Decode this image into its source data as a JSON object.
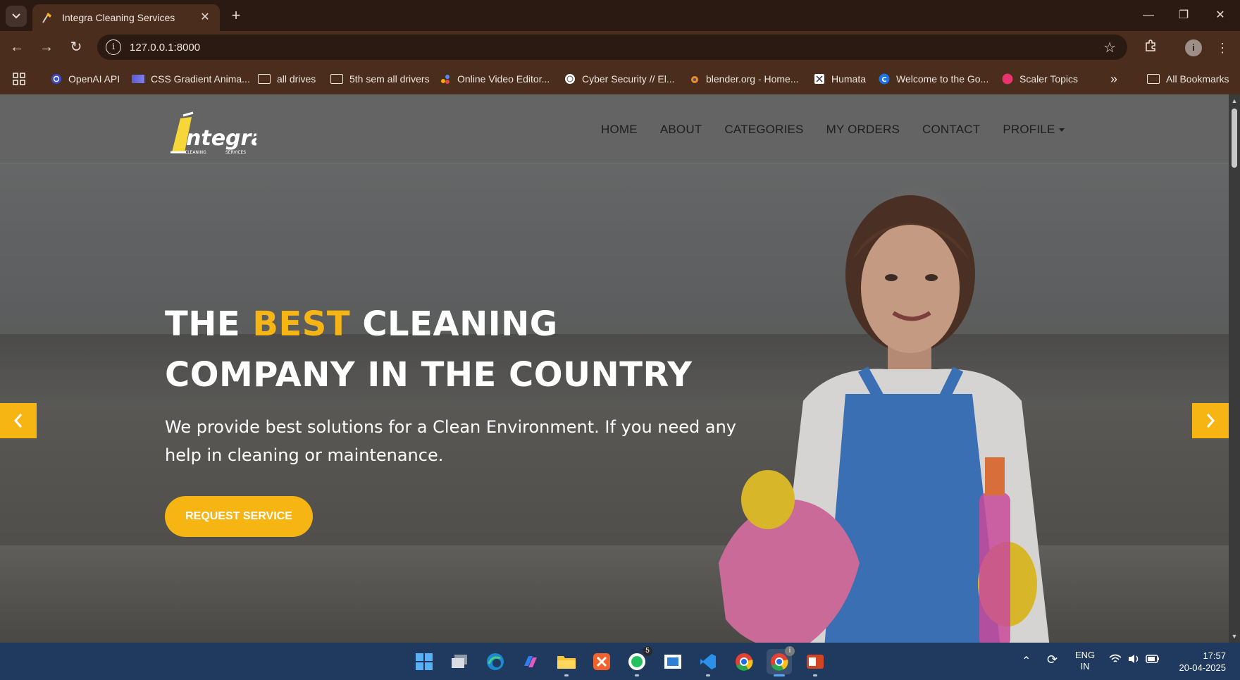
{
  "browser": {
    "tab_title": "Integra Cleaning Services",
    "url": "127.0.0.1:8000",
    "profile_initial": "i",
    "bookmarks": [
      {
        "label": "OpenAI API",
        "icon": "openai-icon"
      },
      {
        "label": "CSS Gradient Anima...",
        "icon": "gradient-icon"
      },
      {
        "label": "all drives",
        "icon": "folder-icon"
      },
      {
        "label": "5th sem all drivers",
        "icon": "folder-icon"
      },
      {
        "label": "Online Video Editor...",
        "icon": "video-editor-icon"
      },
      {
        "label": "Cyber Security // El...",
        "icon": "globe-icon"
      },
      {
        "label": "blender.org - Home...",
        "icon": "blender-icon"
      },
      {
        "label": "Humata",
        "icon": "humata-icon"
      },
      {
        "label": "Welcome to the Go...",
        "icon": "c-icon"
      },
      {
        "label": "Scaler Topics",
        "icon": "scaler-icon"
      }
    ],
    "overflow": "»",
    "all_bookmarks": "All Bookmarks"
  },
  "site": {
    "logo_text": "ntegra",
    "logo_sub_left": "CLEANING",
    "logo_sub_right": "SERVICES",
    "nav": [
      "HOME",
      "ABOUT",
      "CATEGORIES",
      "MY ORDERS",
      "CONTACT",
      "PROFILE"
    ],
    "hero": {
      "line1_pre": "THE ",
      "line1_accent": "BEST",
      "line1_post": " CLEANING",
      "line2": "COMPANY IN THE COUNTRY",
      "subtext": "We provide best solutions for a Clean Environment. If you need any help in cleaning or maintenance.",
      "cta": "REQUEST SERVICE",
      "prev": "‹",
      "next": "›"
    }
  },
  "colors": {
    "accent": "#f7b514",
    "chrome_dark": "#2b1a12",
    "chrome_tab": "#4a2d1c",
    "taskbar": "#1f3a5e"
  },
  "taskbar": {
    "whatsapp_badge": "5",
    "chrome_badge": "i",
    "lang": "ENG",
    "region": "IN",
    "time": "17:57",
    "date": "20-04-2025"
  }
}
